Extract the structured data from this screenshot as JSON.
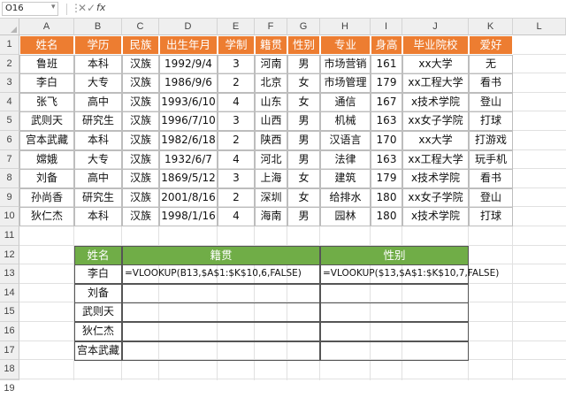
{
  "formula_bar": {
    "name_box": "O16",
    "fx_label": "fx",
    "formula": ""
  },
  "columns": [
    "A",
    "B",
    "C",
    "D",
    "E",
    "F",
    "G",
    "H",
    "I",
    "J",
    "K",
    "L"
  ],
  "rows": [
    "1",
    "2",
    "3",
    "4",
    "5",
    "6",
    "7",
    "8",
    "9",
    "10",
    "11",
    "12",
    "13",
    "14",
    "15",
    "16",
    "17",
    "18",
    "19"
  ],
  "main_table": {
    "headers": [
      "姓名",
      "学历",
      "民族",
      "出生年月",
      "学制",
      "籍贯",
      "性别",
      "专业",
      "身高",
      "毕业院校",
      "爱好"
    ],
    "rows": [
      [
        "鲁班",
        "本科",
        "汉族",
        "1992/9/4",
        "3",
        "河南",
        "男",
        "市场营销",
        "161",
        "xx大学",
        "无"
      ],
      [
        "李白",
        "大专",
        "汉族",
        "1986/9/6",
        "2",
        "北京",
        "女",
        "市场管理",
        "179",
        "xx工程大学",
        "看书"
      ],
      [
        "张飞",
        "高中",
        "汉族",
        "1993/6/10",
        "4",
        "山东",
        "女",
        "通信",
        "167",
        "x技术学院",
        "登山"
      ],
      [
        "武则天",
        "研究生",
        "汉族",
        "1996/7/10",
        "3",
        "山西",
        "男",
        "机械",
        "163",
        "xx女子学院",
        "打球"
      ],
      [
        "宫本武藏",
        "本科",
        "汉族",
        "1982/6/18",
        "2",
        "陕西",
        "男",
        "汉语言",
        "170",
        "xx大学",
        "打游戏"
      ],
      [
        "嫦娥",
        "大专",
        "汉族",
        "1932/6/7",
        "4",
        "河北",
        "男",
        "法律",
        "163",
        "xx工程大学",
        "玩手机"
      ],
      [
        "刘备",
        "高中",
        "汉族",
        "1869/5/12",
        "3",
        "上海",
        "女",
        "建筑",
        "179",
        "x技术学院",
        "看书"
      ],
      [
        "孙尚香",
        "研究生",
        "汉族",
        "2001/8/16",
        "2",
        "深圳",
        "女",
        "给排水",
        "180",
        "xx女子学院",
        "登山"
      ],
      [
        "狄仁杰",
        "本科",
        "汉族",
        "1998/1/16",
        "4",
        "海南",
        "男",
        "园林",
        "180",
        "x技术学院",
        "打球"
      ]
    ]
  },
  "lookup_table": {
    "headers": [
      "姓名",
      "籍贯",
      "性别"
    ],
    "rows": [
      [
        "李白",
        "=VLOOKUP(B13,$A$1:$K$10,6,FALSE)",
        "=VLOOKUP($13,$A$1:$K$10,7,FALSE)"
      ],
      [
        "刘备",
        "",
        ""
      ],
      [
        "武则天",
        "",
        ""
      ],
      [
        "狄仁杰",
        "",
        ""
      ],
      [
        "宫本武藏",
        "",
        ""
      ]
    ]
  },
  "colors": {
    "header_orange": "#ed7d31",
    "header_green": "#70ad47"
  }
}
